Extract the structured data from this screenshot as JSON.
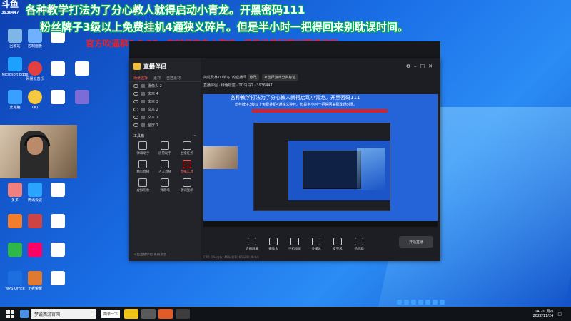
{
  "overlay": {
    "line1": "各种教学打法为了分心教人就得启动小青龙。开黑密码111",
    "line2": "粉丝牌子3级以上免费挂机4通狭义碎片。但是半小时一把得回来别耽误时间。",
    "line3": "官方吹逼群8  3   93，有时候在专心游戏，导致没能回答问题请谅解。"
  },
  "topLogo": {
    "text": "斗鱼",
    "id": "3936447"
  },
  "desktopIcons": [
    {
      "label": "回收站",
      "color": "#7fb6e8"
    },
    {
      "label": "Microsoft Edge",
      "color": "#1ea0ff"
    },
    {
      "label": "此电脑",
      "color": "#3aa0ff"
    },
    {
      "label": "网易云音乐",
      "color": "#e24040"
    },
    {
      "label": "控制面板",
      "color": "#6fb0ff"
    },
    {
      "label": "QQ",
      "color": "#f5c940"
    },
    {
      "label": "多多",
      "color": "#f08080"
    },
    {
      "label": "腾讯会议",
      "color": "#2aa4ff"
    },
    {
      "label": "WPS Office",
      "color": "#1d6fe0"
    },
    {
      "label": "王者荣耀",
      "color": "#e07a30"
    }
  ],
  "app": {
    "brand": "直播伴侣",
    "tabs": [
      "场景选择",
      "素材",
      "自选素材"
    ],
    "sources": [
      "摄像头 2",
      "文本 4",
      "文本 3",
      "文本 2",
      "文本 1",
      "全屏 1"
    ],
    "toolsTitle": "工具箱",
    "tools": [
      "弹幕助手",
      "房管助手",
      "主播任务",
      "精彩直播",
      "人人直播",
      "直播工具",
      "虚拟形象",
      "弹幕墙",
      "歌词显示"
    ],
    "footer": "斗鱼直播伴侣 系统消息",
    "headTitle": "简乱武林TD单马1的直播间",
    "headBtns": [
      "修改",
      "#选择游戏分类标签"
    ],
    "headLine2": "直播伴侣 · 绿色标签 · TD马马1 · 3936447",
    "bottom": [
      "直播屏幕",
      "摄像头",
      "手机投屏",
      "多媒体",
      "麦克风",
      "扬声器"
    ],
    "liveBtn": "开始直播",
    "status": "CPU: 2%  内存: 46%  帧率: 60  码率: 0kb/s"
  },
  "taskbar": {
    "search": "梦说西游官网",
    "chip": "简单一下",
    "time": "14:20 周四",
    "date": "2022/11/24"
  }
}
